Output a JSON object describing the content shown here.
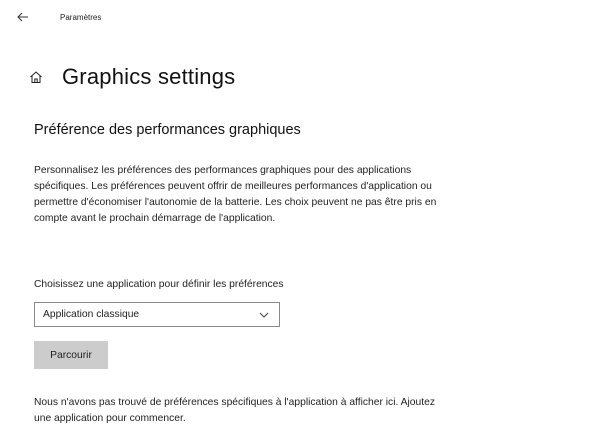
{
  "window": {
    "back_icon": "back-arrow-icon",
    "title": "Paramètres"
  },
  "header": {
    "home_icon": "home-icon",
    "title": "Graphics settings"
  },
  "section": {
    "title": "Préférence des performances graphiques",
    "description": "Personnalisez les préférences des performances graphiques pour des applications spécifiques. Les préférences peuvent offrir de meilleures performances d'application ou permettre d'économiser l'autonomie de la batterie. Les choix peuvent ne pas être pris en compte avant le prochain démarrage de l'application."
  },
  "app_picker": {
    "label": "Choisissez une application pour définir les préférences",
    "selected": "Application classique",
    "chevron_icon": "chevron-down-icon",
    "browse_label": "Parcourir"
  },
  "empty_state": {
    "message": "Nous n'avons pas trouvé de préférences spécifiques à l'application à afficher ici. Ajoutez une application pour commencer."
  }
}
